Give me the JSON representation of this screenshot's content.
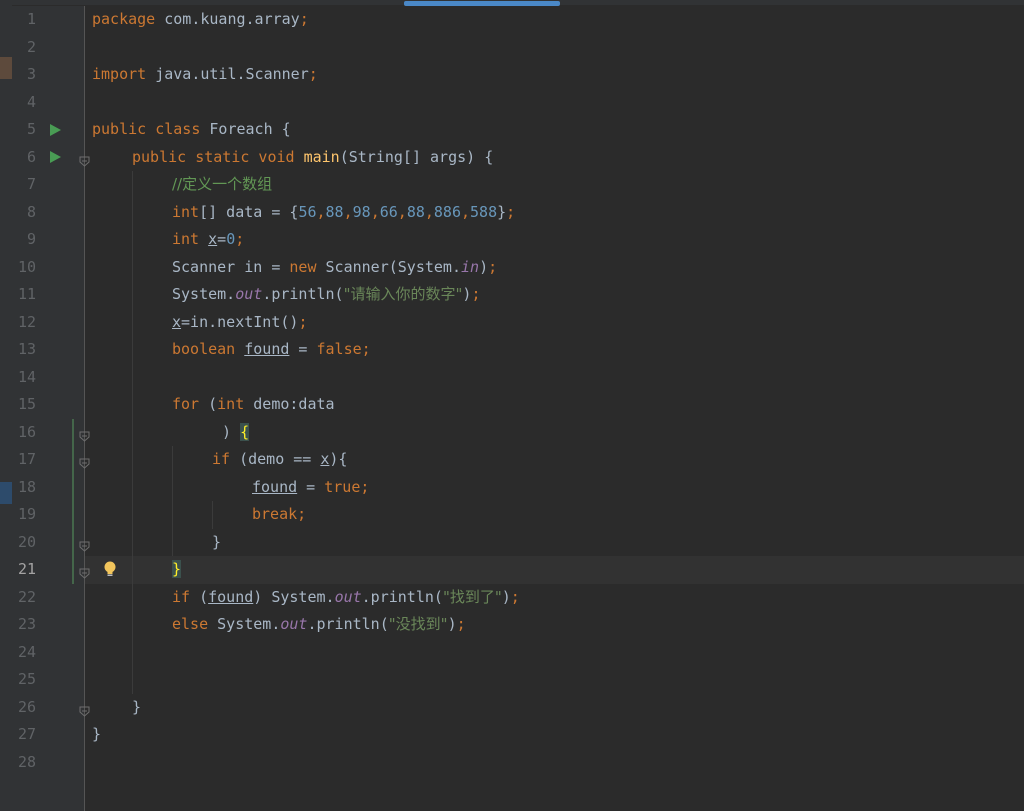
{
  "editor": {
    "current_line": 21,
    "lines": [
      {
        "n": "1",
        "indent": 0,
        "tokens": [
          {
            "t": "package",
            "c": "kw"
          },
          {
            "t": " com.kuang.array"
          },
          {
            "t": ";",
            "c": "kw"
          }
        ]
      },
      {
        "n": "2",
        "indent": 0,
        "tokens": []
      },
      {
        "n": "3",
        "indent": 0,
        "tokens": [
          {
            "t": "import",
            "c": "kw"
          },
          {
            "t": " java.util.Scanner"
          },
          {
            "t": ";",
            "c": "kw"
          }
        ]
      },
      {
        "n": "4",
        "indent": 0,
        "tokens": []
      },
      {
        "n": "5",
        "indent": 0,
        "tokens": [
          {
            "t": "public class",
            "c": "kw"
          },
          {
            "t": " Foreach {"
          }
        ]
      },
      {
        "n": "6",
        "indent": 4,
        "tokens": [
          {
            "t": "public static void",
            "c": "kw"
          },
          {
            "t": " "
          },
          {
            "t": "main",
            "c": "fn"
          },
          {
            "t": "(String[] args) {"
          }
        ]
      },
      {
        "n": "7",
        "indent": 8,
        "tokens": [
          {
            "t": "//定义一个数组",
            "c": "cmt"
          }
        ]
      },
      {
        "n": "8",
        "indent": 8,
        "tokens": [
          {
            "t": "int",
            "c": "kw"
          },
          {
            "t": "[] data = {"
          },
          {
            "t": "56",
            "c": "num"
          },
          {
            "t": ",",
            "c": "kw"
          },
          {
            "t": "88",
            "c": "num"
          },
          {
            "t": ",",
            "c": "kw"
          },
          {
            "t": "98",
            "c": "num"
          },
          {
            "t": ",",
            "c": "kw"
          },
          {
            "t": "66",
            "c": "num"
          },
          {
            "t": ",",
            "c": "kw"
          },
          {
            "t": "88",
            "c": "num"
          },
          {
            "t": ",",
            "c": "kw"
          },
          {
            "t": "886",
            "c": "num"
          },
          {
            "t": ",",
            "c": "kw"
          },
          {
            "t": "588",
            "c": "num"
          },
          {
            "t": "}"
          },
          {
            "t": ";",
            "c": "kw"
          }
        ]
      },
      {
        "n": "9",
        "indent": 8,
        "tokens": [
          {
            "t": "int",
            "c": "kw"
          },
          {
            "t": " "
          },
          {
            "t": "x",
            "c": "ul"
          },
          {
            "t": "="
          },
          {
            "t": "0",
            "c": "num"
          },
          {
            "t": ";",
            "c": "kw"
          }
        ]
      },
      {
        "n": "10",
        "indent": 8,
        "tokens": [
          {
            "t": "Scanner in = "
          },
          {
            "t": "new",
            "c": "kw"
          },
          {
            "t": " Scanner(System."
          },
          {
            "t": "in",
            "c": "static"
          },
          {
            "t": ")"
          },
          {
            "t": ";",
            "c": "kw"
          }
        ]
      },
      {
        "n": "11",
        "indent": 8,
        "tokens": [
          {
            "t": "System."
          },
          {
            "t": "out",
            "c": "static"
          },
          {
            "t": ".println("
          },
          {
            "t": "\"请输入你的数字\"",
            "c": "str"
          },
          {
            "t": ")"
          },
          {
            "t": ";",
            "c": "kw"
          }
        ]
      },
      {
        "n": "12",
        "indent": 8,
        "tokens": [
          {
            "t": "x",
            "c": "ul"
          },
          {
            "t": "=in.nextInt()"
          },
          {
            "t": ";",
            "c": "kw"
          }
        ]
      },
      {
        "n": "13",
        "indent": 8,
        "tokens": [
          {
            "t": "boolean",
            "c": "kw"
          },
          {
            "t": " "
          },
          {
            "t": "found",
            "c": "ul"
          },
          {
            "t": " = "
          },
          {
            "t": "false",
            "c": "kw"
          },
          {
            "t": ";",
            "c": "kw"
          }
        ]
      },
      {
        "n": "14",
        "indent": 0,
        "tokens": []
      },
      {
        "n": "15",
        "indent": 8,
        "tokens": [
          {
            "t": "for",
            "c": "kw"
          },
          {
            "t": " ("
          },
          {
            "t": "int",
            "c": "kw"
          },
          {
            "t": " demo:data"
          }
        ]
      },
      {
        "n": "16",
        "indent": 13,
        "tokens": [
          {
            "t": ") "
          },
          {
            "t": "{",
            "c": "brace-hl"
          }
        ]
      },
      {
        "n": "17",
        "indent": 12,
        "tokens": [
          {
            "t": "if",
            "c": "kw"
          },
          {
            "t": " (demo == "
          },
          {
            "t": "x",
            "c": "ul"
          },
          {
            "t": "){"
          }
        ]
      },
      {
        "n": "18",
        "indent": 16,
        "tokens": [
          {
            "t": "found",
            "c": "ul"
          },
          {
            "t": " = "
          },
          {
            "t": "true",
            "c": "kw"
          },
          {
            "t": ";",
            "c": "kw"
          }
        ]
      },
      {
        "n": "19",
        "indent": 16,
        "tokens": [
          {
            "t": "break;",
            "c": "kw"
          }
        ]
      },
      {
        "n": "20",
        "indent": 12,
        "tokens": [
          {
            "t": "}"
          }
        ]
      },
      {
        "n": "21",
        "indent": 8,
        "tokens": [
          {
            "t": "}",
            "c": "brace-hl"
          }
        ]
      },
      {
        "n": "22",
        "indent": 8,
        "tokens": [
          {
            "t": "if",
            "c": "kw"
          },
          {
            "t": " ("
          },
          {
            "t": "found",
            "c": "ul"
          },
          {
            "t": ") System."
          },
          {
            "t": "out",
            "c": "static"
          },
          {
            "t": ".println("
          },
          {
            "t": "\"找到了\"",
            "c": "str"
          },
          {
            "t": ")"
          },
          {
            "t": ";",
            "c": "kw"
          }
        ]
      },
      {
        "n": "23",
        "indent": 8,
        "tokens": [
          {
            "t": "else",
            "c": "kw"
          },
          {
            "t": " System."
          },
          {
            "t": "out",
            "c": "static"
          },
          {
            "t": ".println("
          },
          {
            "t": "\"没找到\"",
            "c": "str"
          },
          {
            "t": ")"
          },
          {
            "t": ";",
            "c": "kw"
          }
        ]
      },
      {
        "n": "24",
        "indent": 0,
        "tokens": []
      },
      {
        "n": "25",
        "indent": 0,
        "tokens": []
      },
      {
        "n": "26",
        "indent": 4,
        "tokens": [
          {
            "t": "}"
          }
        ]
      },
      {
        "n": "27",
        "indent": 0,
        "tokens": [
          {
            "t": "}"
          }
        ]
      },
      {
        "n": "28",
        "indent": 0,
        "tokens": []
      }
    ],
    "run_icon_lines": [
      5,
      6
    ],
    "fold_icon_lines": [
      6,
      16,
      17,
      20,
      21,
      26
    ],
    "bulb_icon_line": 21
  },
  "colors": {
    "background": "#2b2b2b",
    "gutter": "#313335",
    "keyword": "#cc7832",
    "number": "#6897bb",
    "string": "#6a8759",
    "comment": "#629755",
    "method": "#ffc66d",
    "static_field": "#9876aa",
    "default_text": "#a9b7c6",
    "run_icon": "#499c54"
  }
}
